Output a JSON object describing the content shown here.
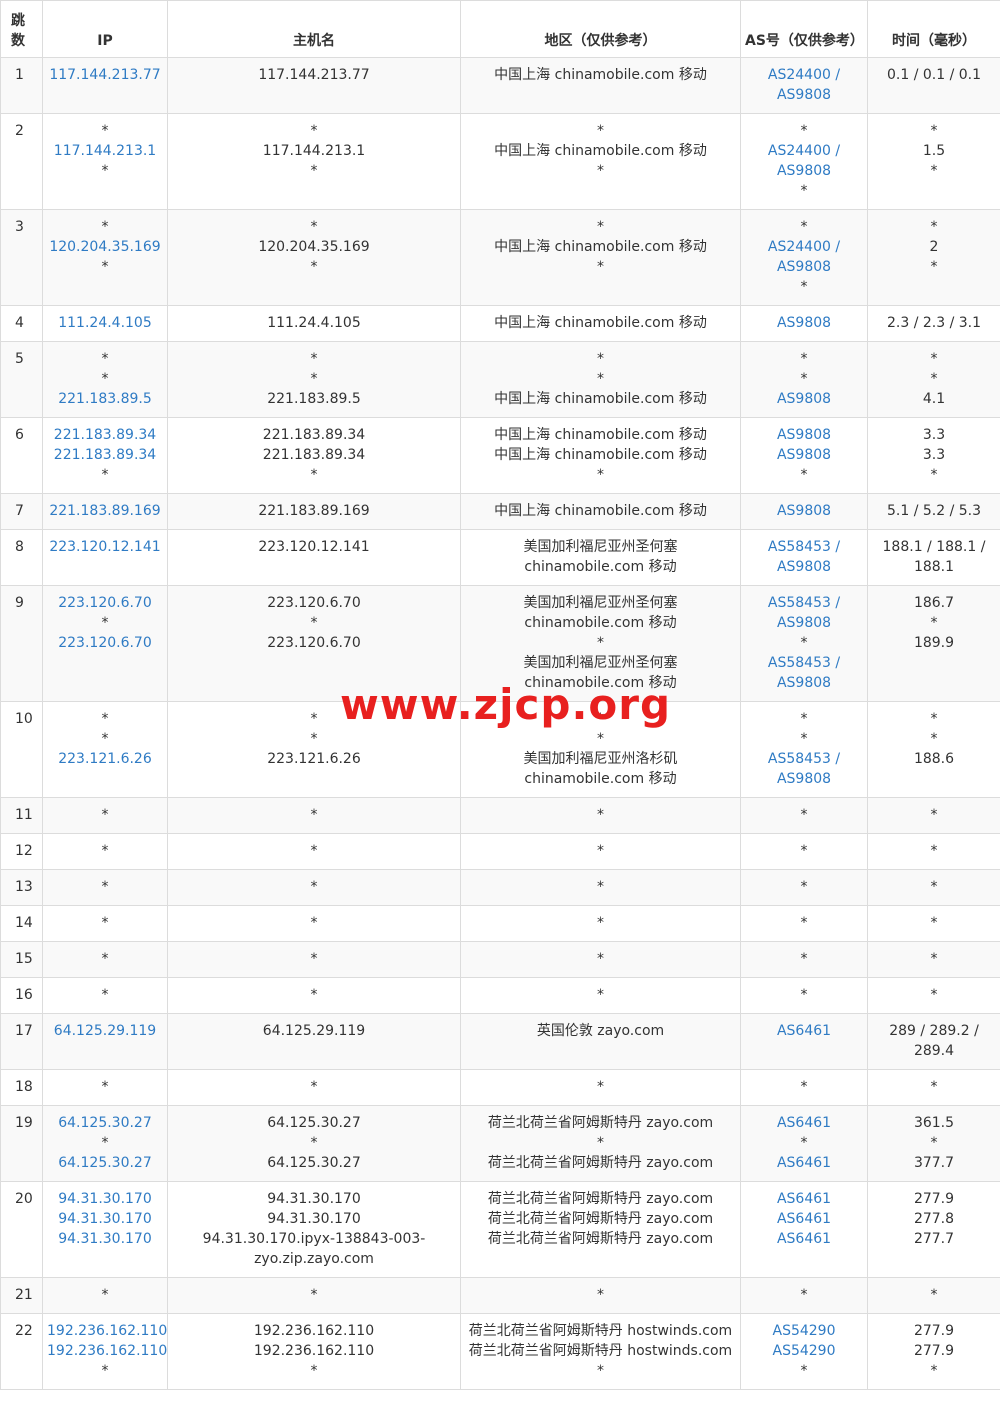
{
  "headers": {
    "hop": "跳数",
    "ip": "IP",
    "host": "主机名",
    "region": "地区（仅供参考）",
    "as": "AS号（仅供参考）",
    "time": "时间（毫秒）"
  },
  "watermark": "www.zjcp.org",
  "rows": [
    {
      "hop": "1",
      "ip": [
        "117.144.213.77"
      ],
      "host": [
        "117.144.213.77"
      ],
      "region": [
        "中国上海 chinamobile.com 移动"
      ],
      "as": [
        "AS24400 /",
        "AS9808"
      ],
      "time": [
        "0.1 / 0.1 / 0.1"
      ]
    },
    {
      "hop": "2",
      "ip": [
        "*",
        "117.144.213.1",
        "*"
      ],
      "host": [
        "*",
        "117.144.213.1",
        "*"
      ],
      "region": [
        "*",
        "中国上海 chinamobile.com 移动",
        "*"
      ],
      "as": [
        "*",
        "AS24400 /",
        "AS9808",
        "*"
      ],
      "time": [
        "*",
        "1.5",
        "*"
      ]
    },
    {
      "hop": "3",
      "ip": [
        "*",
        "120.204.35.169",
        "*"
      ],
      "host": [
        "*",
        "120.204.35.169",
        "*"
      ],
      "region": [
        "*",
        "中国上海 chinamobile.com 移动",
        "*"
      ],
      "as": [
        "*",
        "AS24400 /",
        "AS9808",
        "*"
      ],
      "time": [
        "*",
        "2",
        "*"
      ]
    },
    {
      "hop": "4",
      "ip": [
        "111.24.4.105"
      ],
      "host": [
        "111.24.4.105"
      ],
      "region": [
        "中国上海 chinamobile.com 移动"
      ],
      "as": [
        "AS9808"
      ],
      "time": [
        "2.3 / 2.3 / 3.1"
      ]
    },
    {
      "hop": "5",
      "ip": [
        "*",
        "*",
        "221.183.89.5"
      ],
      "host": [
        "*",
        "*",
        "221.183.89.5"
      ],
      "region": [
        "*",
        "*",
        "中国上海 chinamobile.com 移动"
      ],
      "as": [
        "*",
        "*",
        "AS9808"
      ],
      "time": [
        "*",
        "*",
        "4.1"
      ]
    },
    {
      "hop": "6",
      "ip": [
        "221.183.89.34",
        "221.183.89.34",
        "*"
      ],
      "host": [
        "221.183.89.34",
        "221.183.89.34",
        "*"
      ],
      "region": [
        "中国上海 chinamobile.com 移动",
        "中国上海 chinamobile.com 移动",
        "*"
      ],
      "as": [
        "AS9808",
        "AS9808",
        "*"
      ],
      "time": [
        "3.3",
        "3.3",
        "*"
      ]
    },
    {
      "hop": "7",
      "ip": [
        "221.183.89.169"
      ],
      "host": [
        "221.183.89.169"
      ],
      "region": [
        "中国上海 chinamobile.com 移动"
      ],
      "as": [
        "AS9808"
      ],
      "time": [
        "5.1 / 5.2 / 5.3"
      ]
    },
    {
      "hop": "8",
      "ip": [
        "223.120.12.141"
      ],
      "host": [
        "223.120.12.141"
      ],
      "region": [
        "美国加利福尼亚州圣何塞",
        "chinamobile.com 移动"
      ],
      "as": [
        "AS58453 /",
        "AS9808"
      ],
      "time": [
        "188.1 / 188.1 /",
        "188.1"
      ]
    },
    {
      "hop": "9",
      "ip": [
        "223.120.6.70",
        "*",
        "223.120.6.70"
      ],
      "host": [
        "223.120.6.70",
        "*",
        "223.120.6.70"
      ],
      "region": [
        "美国加利福尼亚州圣何塞",
        "chinamobile.com 移动",
        "*",
        "美国加利福尼亚州圣何塞",
        "chinamobile.com 移动"
      ],
      "as": [
        "AS58453 /",
        "AS9808",
        "*",
        "AS58453 /",
        "AS9808"
      ],
      "time": [
        "186.7",
        "*",
        "189.9"
      ]
    },
    {
      "hop": "10",
      "ip": [
        "*",
        "*",
        "223.121.6.26"
      ],
      "host": [
        "*",
        "*",
        "223.121.6.26"
      ],
      "region": [
        "*",
        "*",
        "美国加利福尼亚州洛杉矶",
        "chinamobile.com 移动"
      ],
      "as": [
        "*",
        "*",
        "AS58453 /",
        "AS9808"
      ],
      "time": [
        "*",
        "*",
        "188.6"
      ]
    },
    {
      "hop": "11",
      "ip": [
        "*"
      ],
      "host": [
        "*"
      ],
      "region": [
        "*"
      ],
      "as": [
        "*"
      ],
      "time": [
        "*"
      ]
    },
    {
      "hop": "12",
      "ip": [
        "*"
      ],
      "host": [
        "*"
      ],
      "region": [
        "*"
      ],
      "as": [
        "*"
      ],
      "time": [
        "*"
      ]
    },
    {
      "hop": "13",
      "ip": [
        "*"
      ],
      "host": [
        "*"
      ],
      "region": [
        "*"
      ],
      "as": [
        "*"
      ],
      "time": [
        "*"
      ]
    },
    {
      "hop": "14",
      "ip": [
        "*"
      ],
      "host": [
        "*"
      ],
      "region": [
        "*"
      ],
      "as": [
        "*"
      ],
      "time": [
        "*"
      ]
    },
    {
      "hop": "15",
      "ip": [
        "*"
      ],
      "host": [
        "*"
      ],
      "region": [
        "*"
      ],
      "as": [
        "*"
      ],
      "time": [
        "*"
      ]
    },
    {
      "hop": "16",
      "ip": [
        "*"
      ],
      "host": [
        "*"
      ],
      "region": [
        "*"
      ],
      "as": [
        "*"
      ],
      "time": [
        "*"
      ]
    },
    {
      "hop": "17",
      "ip": [
        "64.125.29.119"
      ],
      "host": [
        "64.125.29.119"
      ],
      "region": [
        "英国伦敦 zayo.com"
      ],
      "as": [
        "AS6461"
      ],
      "time": [
        "289 / 289.2 /",
        "289.4"
      ]
    },
    {
      "hop": "18",
      "ip": [
        "*"
      ],
      "host": [
        "*"
      ],
      "region": [
        "*"
      ],
      "as": [
        "*"
      ],
      "time": [
        "*"
      ]
    },
    {
      "hop": "19",
      "ip": [
        "64.125.30.27",
        "*",
        "64.125.30.27"
      ],
      "host": [
        "64.125.30.27",
        "*",
        "64.125.30.27"
      ],
      "region": [
        "荷兰北荷兰省阿姆斯特丹 zayo.com",
        "*",
        "荷兰北荷兰省阿姆斯特丹 zayo.com"
      ],
      "as": [
        "AS6461",
        "*",
        "AS6461"
      ],
      "time": [
        "361.5",
        "*",
        "377.7"
      ]
    },
    {
      "hop": "20",
      "ip": [
        "94.31.30.170",
        "94.31.30.170",
        "94.31.30.170"
      ],
      "host": [
        "94.31.30.170",
        "94.31.30.170",
        "94.31.30.170.ipyx-138843-003-",
        "zyo.zip.zayo.com"
      ],
      "region": [
        "荷兰北荷兰省阿姆斯特丹 zayo.com",
        "荷兰北荷兰省阿姆斯特丹 zayo.com",
        "荷兰北荷兰省阿姆斯特丹 zayo.com"
      ],
      "as": [
        "AS6461",
        "AS6461",
        "AS6461"
      ],
      "time": [
        "277.9",
        "277.8",
        "277.7"
      ]
    },
    {
      "hop": "21",
      "ip": [
        "*"
      ],
      "host": [
        "*"
      ],
      "region": [
        "*"
      ],
      "as": [
        "*"
      ],
      "time": [
        "*"
      ]
    },
    {
      "hop": "22",
      "ip": [
        "192.236.162.110",
        "192.236.162.110",
        "*"
      ],
      "host": [
        "192.236.162.110",
        "192.236.162.110",
        "*"
      ],
      "region": [
        "荷兰北荷兰省阿姆斯特丹 hostwinds.com",
        "荷兰北荷兰省阿姆斯特丹 hostwinds.com",
        "*"
      ],
      "as": [
        "AS54290",
        "AS54290",
        "*"
      ],
      "time": [
        "277.9",
        "277.9",
        "*"
      ]
    }
  ]
}
